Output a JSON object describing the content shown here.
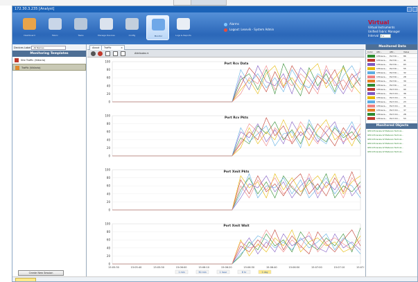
{
  "window": {
    "title": "172.30.3.235 [Analyst]"
  },
  "ribbon": {
    "buttons": [
      {
        "label": "Dashboard",
        "icon": "pie-chart-icon"
      },
      {
        "label": "Fabric",
        "icon": "fabric-icon"
      },
      {
        "label": "Tasks",
        "icon": "tasks-icon"
      },
      {
        "label": "Manage Devices",
        "icon": "devices-icon"
      },
      {
        "label": "Config",
        "icon": "tools-icon"
      },
      {
        "label": "Monitor",
        "icon": "monitor-icon",
        "active": true
      },
      {
        "label": "Logs & Reports",
        "icon": "reports-icon"
      }
    ]
  },
  "status": {
    "line1": "Alarms",
    "line2": "Logout: Lesevik - System Admin"
  },
  "brand": {
    "logo": "Virtual",
    "line1": "Virtual Instruments",
    "line2": "Unified Fabric Manager",
    "interval_label": "Interval",
    "interval_value": "5 s"
  },
  "left": {
    "devices_label": "Devices Label",
    "devices_select": "All Names",
    "panel_title": "Monitoring Templates",
    "templates": [
      {
        "label": "Site Traffic (Vidiaria)",
        "selected": false
      },
      {
        "label": "Traffic (Vidiaria)",
        "selected": true
      }
    ],
    "create_button": "Create New Session"
  },
  "center": {
    "tabs": [
      "About",
      "Traffic"
    ],
    "toolbar_attribute": "Attributes"
  },
  "chart_data": [
    {
      "type": "line",
      "title": "Port Rcv Data",
      "ylim": [
        0,
        100
      ],
      "yticks": [
        0,
        20,
        40,
        60,
        80,
        100
      ],
      "x": [
        "15:05:30",
        "15:05:40",
        "15:05:50",
        "15:06:00",
        "15:06:10",
        "15:06:20",
        "15:06:30",
        "15:06:40",
        "15:06:50",
        "15:07:00",
        "15:07:10",
        "15:07:20"
      ],
      "series": [
        {
          "color": "#2e8b2e",
          "values": [
            0,
            0,
            0,
            0,
            0,
            0,
            0,
            0,
            0,
            0,
            0,
            0,
            0,
            0,
            0,
            55,
            70,
            30,
            80,
            20,
            95,
            50,
            15,
            85,
            40,
            70,
            25,
            90,
            35,
            60
          ]
        },
        {
          "color": "#c0392b",
          "values": [
            0,
            0,
            0,
            0,
            0,
            0,
            0,
            0,
            0,
            0,
            0,
            0,
            0,
            0,
            0,
            40,
            85,
            60,
            25,
            75,
            35,
            90,
            55,
            20,
            65,
            45,
            80,
            30,
            70,
            40
          ]
        },
        {
          "color": "#7e57c2",
          "values": [
            0,
            0,
            0,
            0,
            0,
            0,
            0,
            0,
            0,
            0,
            0,
            0,
            0,
            0,
            0,
            65,
            30,
            90,
            50,
            40,
            70,
            20,
            85,
            60,
            30,
            80,
            50,
            20,
            60,
            75
          ]
        },
        {
          "color": "#e6b800",
          "values": [
            0,
            0,
            0,
            0,
            0,
            0,
            0,
            0,
            0,
            0,
            0,
            0,
            0,
            0,
            0,
            30,
            55,
            20,
            70,
            90,
            40,
            60,
            30,
            75,
            95,
            35,
            60,
            85,
            45,
            20
          ]
        },
        {
          "color": "#5dade2",
          "values": [
            0,
            0,
            0,
            0,
            0,
            0,
            0,
            0,
            0,
            0,
            0,
            0,
            0,
            0,
            0,
            80,
            45,
            70,
            35,
            60,
            25,
            80,
            45,
            35,
            70,
            55,
            20,
            65,
            90,
            50
          ]
        },
        {
          "color": "#f08080",
          "values": [
            0,
            0,
            0,
            0,
            0,
            0,
            0,
            0,
            0,
            0,
            0,
            0,
            0,
            0,
            0,
            20,
            60,
            45,
            90,
            30,
            60,
            40,
            70,
            50,
            20,
            90,
            40,
            55,
            25,
            85
          ]
        }
      ]
    },
    {
      "type": "line",
      "title": "Port Rcv Pkts",
      "ylim": [
        0,
        100
      ],
      "yticks": [
        0,
        20,
        40,
        60,
        80,
        100
      ],
      "x": [
        "15:05:30",
        "15:05:40",
        "15:05:50",
        "15:06:00",
        "15:06:10",
        "15:06:20",
        "15:06:30",
        "15:06:40",
        "15:06:50",
        "15:07:00",
        "15:07:10",
        "15:07:20"
      ],
      "series": [
        {
          "color": "#2e8b2e",
          "values": [
            0,
            0,
            0,
            0,
            0,
            0,
            0,
            0,
            0,
            0,
            0,
            0,
            0,
            0,
            0,
            45,
            30,
            75,
            55,
            85,
            40,
            65,
            30,
            80,
            50,
            35,
            70,
            45,
            60,
            30
          ]
        },
        {
          "color": "#c0392b",
          "values": [
            0,
            0,
            0,
            0,
            0,
            0,
            0,
            0,
            0,
            0,
            0,
            0,
            0,
            0,
            0,
            30,
            60,
            40,
            95,
            50,
            75,
            30,
            60,
            40,
            80,
            55,
            25,
            70,
            40,
            55
          ]
        },
        {
          "color": "#7e57c2",
          "values": [
            0,
            0,
            0,
            0,
            0,
            0,
            0,
            0,
            0,
            0,
            0,
            0,
            0,
            0,
            0,
            60,
            45,
            80,
            35,
            65,
            30,
            85,
            50,
            70,
            35,
            60,
            85,
            30,
            75,
            45
          ]
        },
        {
          "color": "#e6b800",
          "values": [
            0,
            0,
            0,
            0,
            0,
            0,
            0,
            0,
            0,
            0,
            0,
            0,
            0,
            0,
            0,
            20,
            70,
            30,
            60,
            40,
            90,
            45,
            75,
            25,
            65,
            90,
            40,
            60,
            25,
            70
          ]
        },
        {
          "color": "#5dade2",
          "values": [
            0,
            0,
            0,
            0,
            0,
            0,
            0,
            0,
            0,
            0,
            0,
            0,
            0,
            0,
            0,
            70,
            35,
            55,
            75,
            25,
            55,
            60,
            20,
            90,
            45,
            30,
            75,
            50,
            85,
            35
          ]
        },
        {
          "color": "#f08080",
          "values": [
            0,
            0,
            0,
            0,
            0,
            0,
            0,
            0,
            0,
            0,
            0,
            0,
            0,
            0,
            0,
            35,
            80,
            60,
            25,
            70,
            45,
            35,
            85,
            55,
            30,
            75,
            55,
            35,
            50,
            80
          ]
        }
      ]
    },
    {
      "type": "line",
      "title": "Port Xmit Pkts",
      "ylim": [
        0,
        100
      ],
      "yticks": [
        0,
        20,
        40,
        60,
        80,
        100
      ],
      "x": [
        "15:05:30",
        "15:05:40",
        "15:05:50",
        "15:06:00",
        "15:06:10",
        "15:06:20",
        "15:06:30",
        "15:06:40",
        "15:06:50",
        "15:07:00",
        "15:07:10",
        "15:07:20"
      ],
      "series": [
        {
          "color": "#2e8b2e",
          "values": [
            0,
            0,
            0,
            0,
            0,
            0,
            0,
            0,
            0,
            0,
            0,
            0,
            0,
            0,
            0,
            50,
            80,
            40,
            70,
            30,
            85,
            55,
            35,
            75,
            50,
            90,
            30,
            60,
            45,
            70
          ]
        },
        {
          "color": "#c0392b",
          "values": [
            0,
            0,
            0,
            0,
            0,
            0,
            0,
            0,
            0,
            0,
            0,
            0,
            0,
            0,
            0,
            75,
            40,
            85,
            45,
            65,
            35,
            70,
            90,
            40,
            65,
            35,
            80,
            45,
            95,
            40
          ]
        },
        {
          "color": "#7e57c2",
          "values": [
            0,
            0,
            0,
            0,
            0,
            0,
            0,
            0,
            0,
            0,
            0,
            0,
            0,
            0,
            0,
            30,
            65,
            55,
            85,
            45,
            70,
            30,
            60,
            80,
            30,
            70,
            50,
            85,
            35,
            60
          ]
        },
        {
          "color": "#e6b800",
          "values": [
            0,
            0,
            0,
            0,
            0,
            0,
            0,
            0,
            0,
            0,
            0,
            0,
            0,
            0,
            0,
            85,
            55,
            70,
            30,
            90,
            50,
            80,
            45,
            65,
            85,
            55,
            90,
            40,
            70,
            85
          ]
        },
        {
          "color": "#5dade2",
          "values": [
            0,
            0,
            0,
            0,
            0,
            0,
            0,
            0,
            0,
            0,
            0,
            0,
            0,
            0,
            0,
            40,
            90,
            30,
            60,
            55,
            80,
            40,
            75,
            30,
            55,
            80,
            40,
            70,
            60,
            30
          ]
        },
        {
          "color": "#f08080",
          "values": [
            0,
            0,
            0,
            0,
            0,
            0,
            0,
            0,
            0,
            0,
            0,
            0,
            0,
            0,
            0,
            60,
            30,
            75,
            50,
            80,
            40,
            60,
            35,
            90,
            40,
            60,
            70,
            30,
            80,
            55
          ]
        }
      ]
    },
    {
      "type": "line",
      "title": "Port Xmit Wait",
      "ylim": [
        0,
        100
      ],
      "yticks": [
        0,
        20,
        40,
        60,
        80,
        100
      ],
      "x": [
        "15:05:30",
        "15:05:40",
        "15:05:50",
        "15:06:00",
        "15:06:10",
        "15:06:20",
        "15:06:30",
        "15:06:40",
        "15:06:50",
        "15:07:00",
        "15:07:10",
        "15:07:20"
      ],
      "series": [
        {
          "color": "#2e8b2e",
          "values": [
            0,
            0,
            0,
            0,
            0,
            0,
            0,
            0,
            0,
            0,
            0,
            0,
            0,
            0,
            0,
            20,
            55,
            35,
            75,
            45,
            60,
            30,
            80,
            50,
            35,
            65,
            45,
            75,
            30,
            90
          ]
        },
        {
          "color": "#c0392b",
          "values": [
            0,
            0,
            0,
            0,
            0,
            0,
            0,
            0,
            0,
            0,
            0,
            0,
            0,
            0,
            0,
            45,
            30,
            60,
            40,
            85,
            35,
            70,
            45,
            25,
            80,
            50,
            30,
            60,
            85,
            45
          ]
        },
        {
          "color": "#7e57c2",
          "values": [
            0,
            0,
            0,
            0,
            0,
            0,
            0,
            0,
            0,
            0,
            0,
            0,
            0,
            0,
            0,
            35,
            65,
            25,
            55,
            30,
            75,
            45,
            60,
            70,
            40,
            30,
            75,
            40,
            55,
            35
          ]
        },
        {
          "color": "#e6b800",
          "values": [
            0,
            0,
            0,
            0,
            0,
            0,
            0,
            0,
            0,
            0,
            0,
            0,
            0,
            0,
            0,
            60,
            20,
            50,
            30,
            65,
            45,
            85,
            30,
            55,
            65,
            45,
            55,
            30,
            40,
            70
          ]
        },
        {
          "color": "#5dade2",
          "values": [
            0,
            0,
            0,
            0,
            0,
            0,
            0,
            0,
            0,
            0,
            0,
            0,
            0,
            0,
            0,
            25,
            45,
            70,
            60,
            40,
            55,
            35,
            65,
            40,
            55,
            75,
            35,
            65,
            50,
            25
          ]
        },
        {
          "color": "#f08080",
          "values": [
            0,
            0,
            0,
            0,
            0,
            0,
            0,
            0,
            0,
            0,
            0,
            0,
            0,
            0,
            0,
            55,
            40,
            45,
            85,
            55,
            30,
            60,
            40,
            80,
            30,
            55,
            65,
            50,
            35,
            60
          ]
        }
      ]
    }
  ],
  "time_range": [
    "1 min",
    "30 min",
    "1 hour",
    "8 hr",
    "1 day"
  ],
  "right": {
    "monitored_title": "Monitored Data",
    "cols": [
      "Color",
      "Attr...",
      "Attr...",
      "Value"
    ],
    "rows": [
      {
        "color": "#2e8b2e",
        "a": "Infinisca...",
        "b": "Port Rc...",
        "c": "86"
      },
      {
        "color": "#c0392b",
        "a": "Infinisca...",
        "b": "Port Rc...",
        "c": "41"
      },
      {
        "color": "#7e57c2",
        "a": "Infinisca...",
        "b": "Port Rc...",
        "c": "63"
      },
      {
        "color": "#e6b800",
        "a": "Infinisca...",
        "b": "Port Rc...",
        "c": "55"
      },
      {
        "color": "#5dade2",
        "a": "Infinisca...",
        "b": "Port Rc...",
        "c": "32"
      },
      {
        "color": "#f08080",
        "a": "Infinisca...",
        "b": "Port Rc...",
        "c": "28"
      },
      {
        "color": "#e67e22",
        "a": "Infinisca...",
        "b": "Port Rc...",
        "c": "39"
      },
      {
        "color": "#2e8b2e",
        "a": "Infinisca...",
        "b": "Port Rc...",
        "c": "12"
      },
      {
        "color": "#c0392b",
        "a": "Infinisca...",
        "b": "Port Xm...",
        "c": "90"
      },
      {
        "color": "#7e57c2",
        "a": "Infinisca...",
        "b": "Port Xm...",
        "c": "36"
      },
      {
        "color": "#e6b800",
        "a": "Infinisca...",
        "b": "Port Xm...",
        "c": "71"
      },
      {
        "color": "#5dade2",
        "a": "Infinisca...",
        "b": "Port Xm...",
        "c": "23"
      },
      {
        "color": "#f08080",
        "a": "Infinisca...",
        "b": "Port Xm...",
        "c": "41"
      },
      {
        "color": "#e67e22",
        "a": "Infinisca...",
        "b": "Port Xm...",
        "c": "37"
      },
      {
        "color": "#2e8b2e",
        "a": "Infinisca...",
        "b": "Port Xm...",
        "c": "28"
      },
      {
        "color": "#c0392b",
        "a": "Infinisca...",
        "b": "Port Xm...",
        "c": "53"
      }
    ],
    "objects_title": "Monitored Objects",
    "objects": [
      "IWO Infiniscale-IV Mellanox Technol...",
      "IWO Infiniscale-IV Mellanox Technol...",
      "IWO Infiniscale-IV Mellanox Technol...",
      "IWO Infiniscale-IV Mellanox Technol...",
      "IWO Infiniscale-IV Mellanox Technol...",
      "IWO Infiniscale-IV Mellanox Technol..."
    ]
  }
}
